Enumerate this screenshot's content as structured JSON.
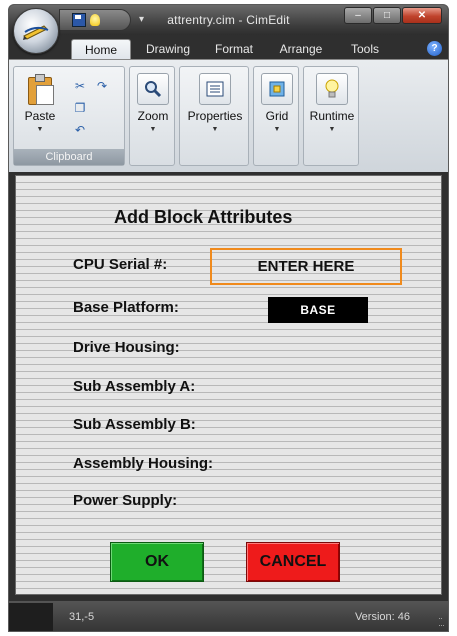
{
  "window": {
    "title": "attrentry.cim - CimEdit",
    "controls": {
      "minimize": "–",
      "maximize": "□",
      "close": "✕"
    }
  },
  "tabs": [
    {
      "label": "Home",
      "active": true
    },
    {
      "label": "Drawing",
      "active": false
    },
    {
      "label": "Format",
      "active": false
    },
    {
      "label": "Arrange",
      "active": false
    },
    {
      "label": "Tools",
      "active": false
    }
  ],
  "ribbon": {
    "clipboard": {
      "paste_label": "Paste",
      "group_label": "Clipboard"
    },
    "zoom_label": "Zoom",
    "properties_label": "Properties",
    "grid_label": "Grid",
    "runtime_label": "Runtime"
  },
  "form": {
    "heading": "Add Block Attributes",
    "cpu_serial_label": "CPU Serial #:",
    "cpu_serial_value": "ENTER HERE",
    "base_platform_label": "Base Platform:",
    "base_platform_value": "BASE",
    "drive_housing_label": "Drive Housing:",
    "sub_assembly_a_label": "Sub Assembly A:",
    "sub_assembly_b_label": "Sub Assembly B:",
    "assembly_housing_label": "Assembly Housing:",
    "power_supply_label": "Power Supply:",
    "ok_label": "OK",
    "cancel_label": "CANCEL"
  },
  "status": {
    "coords": "31,-5",
    "version": "Version: 46"
  },
  "colors": {
    "ok_green": "#1fae2b",
    "cancel_red": "#ee1b1b",
    "highlight_orange": "#f08a1c"
  }
}
